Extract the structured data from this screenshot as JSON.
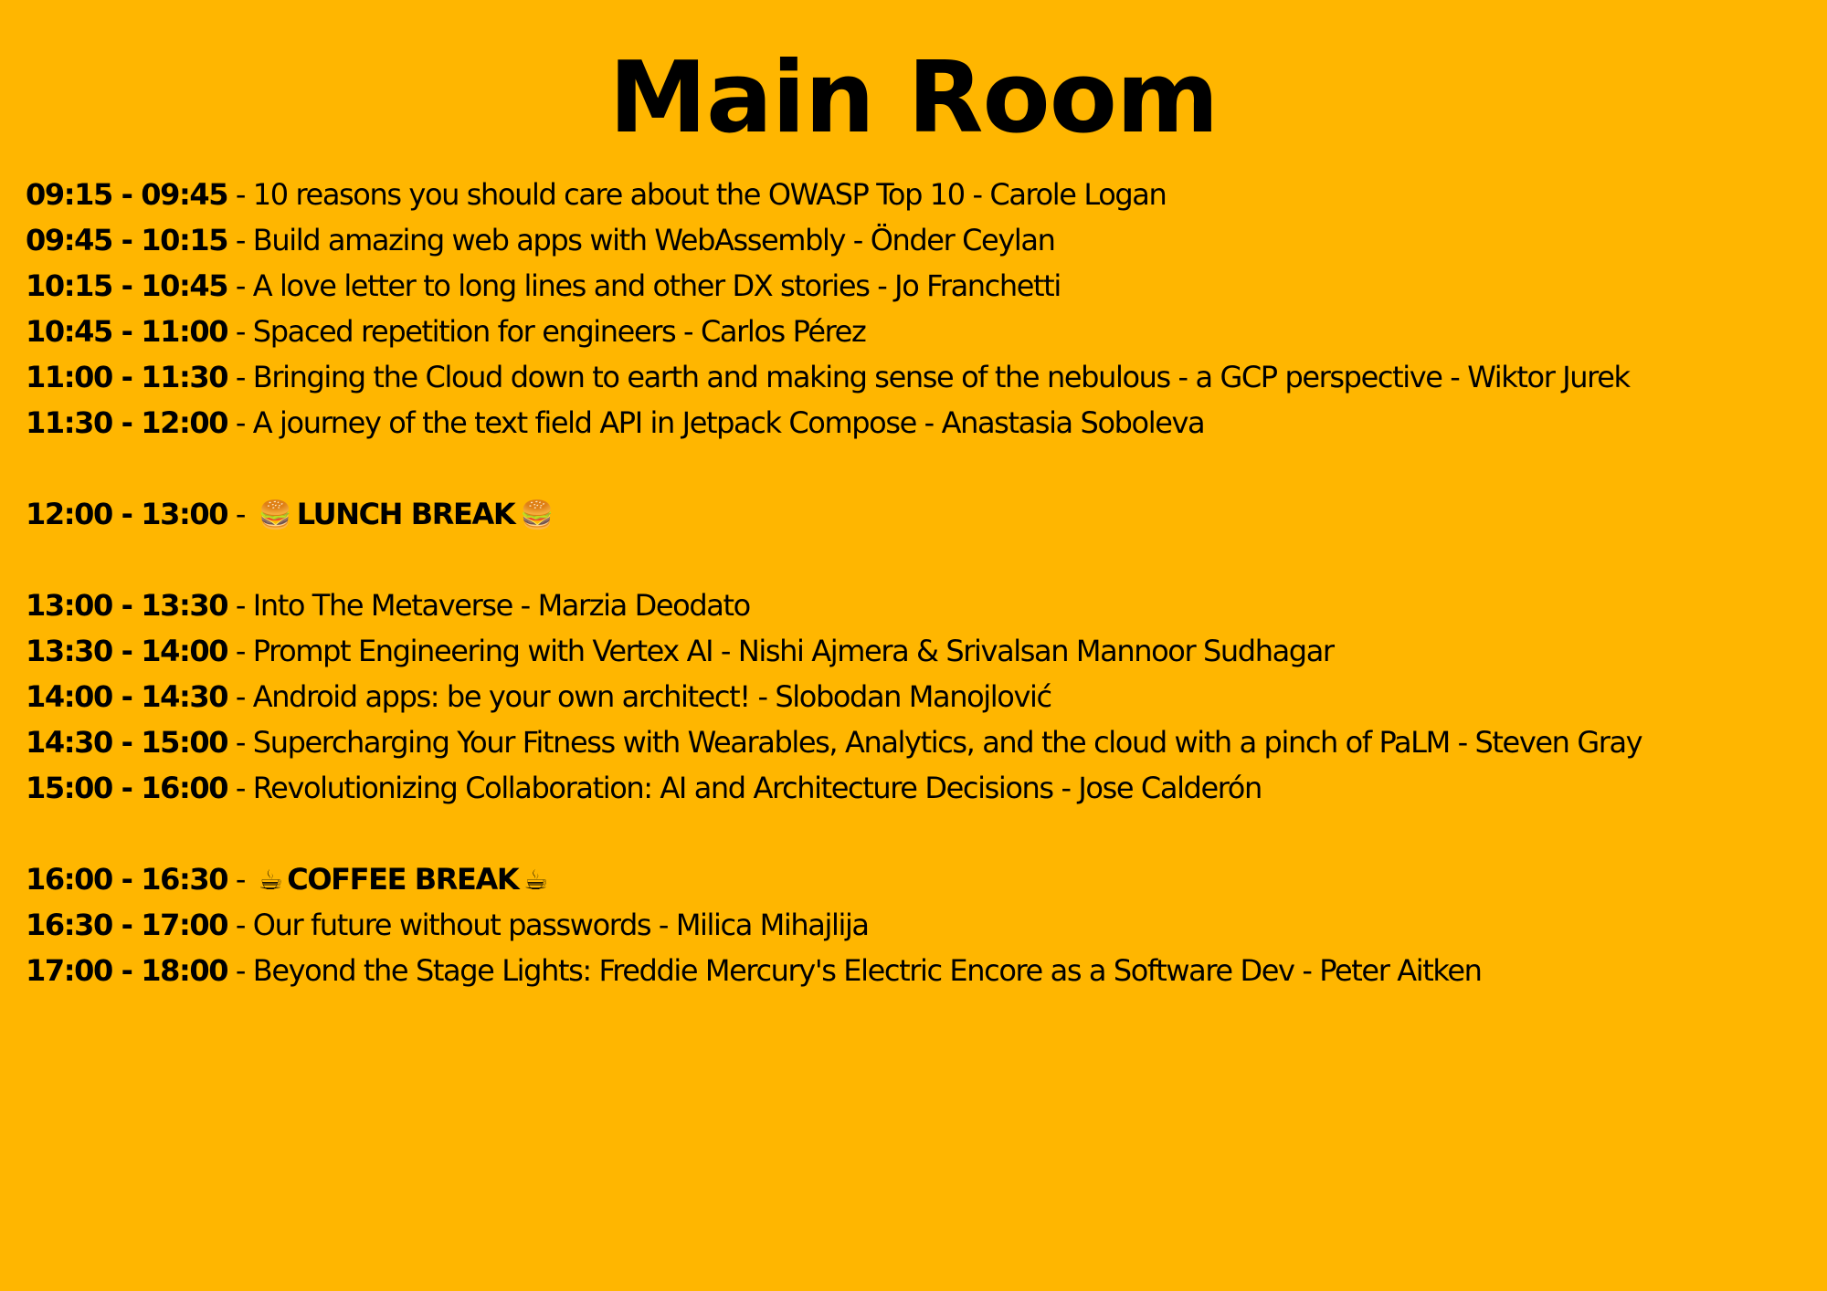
{
  "page": {
    "title": "Main Room",
    "background": "#FFB600"
  },
  "schedule": [
    {
      "time": "09:15 - 09:45",
      "text": " - 10 reasons you should care about the OWASP Top 10 - Carole Logan"
    },
    {
      "time": "09:45 - 10:15",
      "text": " - Build amazing web apps with WebAssembly - Önder Ceylan"
    },
    {
      "time": "10:15 - 10:45",
      "text": " - A love letter to long lines and other DX stories - Jo Franchetti"
    },
    {
      "time": "10:45 - 11:00",
      "text": " - Spaced repetition for engineers - Carlos Pérez"
    },
    {
      "time": "11:00 - 11:30",
      "text": " - Bringing the Cloud down to earth and making sense of the nebulous - a GCP perspective - Wiktor Jurek"
    },
    {
      "time": "11:30 - 12:00",
      "text": " - A journey of the text field API in Jetpack Compose - Anastasia Soboleva"
    },
    {
      "time": "12:00 - 13:00",
      "sep": " - ",
      "emoji": "🍔",
      "label": "LUNCH BREAK"
    },
    {
      "time": "13:00 - 13:30",
      "text": " - Into The Metaverse - Marzia Deodato"
    },
    {
      "time": "13:30 - 14:00",
      "text": " - Prompt Engineering with Vertex AI - Nishi Ajmera & Srivalsan Mannoor Sudhagar"
    },
    {
      "time": "14:00 - 14:30",
      "text": " - Android apps: be your own architect! - Slobodan Manojlović"
    },
    {
      "time": "14:30 - 15:00",
      "text": " - Supercharging Your Fitness with Wearables, Analytics, and the cloud with a pinch of PaLM - Steven Gray"
    },
    {
      "time": "15:00 - 16:00",
      "text": " - Revolutionizing Collaboration: AI and Architecture Decisions - Jose Calderón"
    },
    {
      "time": "16:00 - 16:30",
      "sep": " - ",
      "emoji": "☕",
      "label": "COFFEE BREAK"
    },
    {
      "time": "16:30 - 17:00",
      "text": " - Our future without passwords - Milica Mihajlija"
    },
    {
      "time": "17:00 - 18:00",
      "text": " - Beyond the Stage Lights: Freddie Mercury's Electric Encore as a Software Dev - Peter Aitken"
    }
  ]
}
